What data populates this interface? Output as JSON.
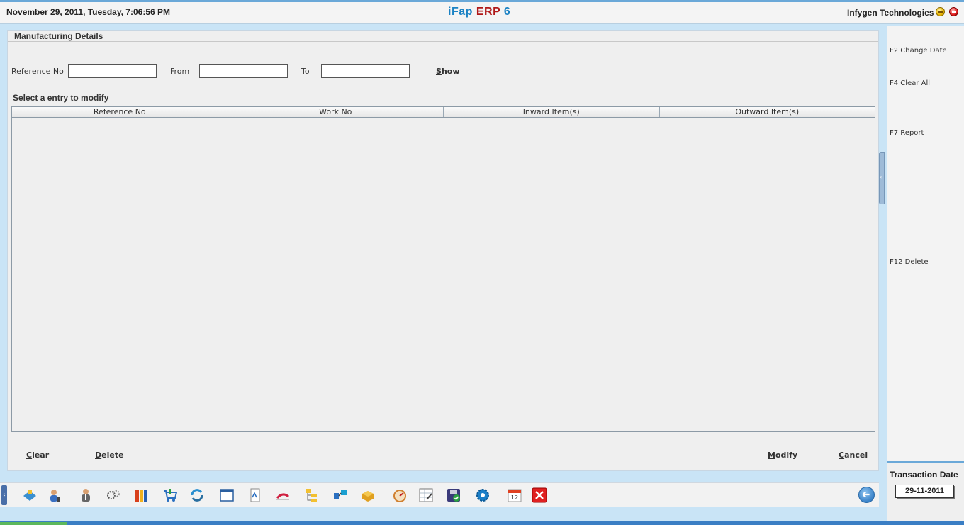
{
  "header": {
    "datetime": "November  29, 2011, Tuesday, 7:06:56 PM",
    "brand_ifap": "iFap",
    "brand_erp": "ERP",
    "brand_version": "6",
    "company": "Infygen Technologies"
  },
  "panel": {
    "title": "Manufacturing Details",
    "filters": {
      "reference_label": "Reference No",
      "reference_value": "",
      "from_label": "From",
      "from_value": "",
      "to_label": "To",
      "to_value": "",
      "show_prefix": "S",
      "show_rest": "how"
    },
    "select_label": "Select a entry to modify",
    "grid": {
      "columns": [
        "Reference No",
        "Work No",
        "Inward Item(s)",
        "Outward Item(s)"
      ],
      "rows": []
    },
    "actions": {
      "clear_prefix": "C",
      "clear_rest": "lear",
      "delete_prefix": "D",
      "delete_rest": "elete",
      "modify_prefix": "M",
      "modify_rest": "odify",
      "cancel_prefix": "C",
      "cancel_rest": "ancel"
    }
  },
  "sidebar": {
    "shortcuts": [
      "F2 Change Date",
      "F4 Clear All",
      "F7 Report",
      "F12 Delete"
    ],
    "transaction_label": "Transaction Date",
    "transaction_date": "29-11-2011"
  },
  "toolbar": {
    "icons": [
      "ledger-icon",
      "user-phone-icon",
      "staff-icon",
      "gears-icon",
      "books-icon",
      "shopping-cart-icon",
      "refresh-icon",
      "window-icon",
      "document-icon",
      "chart-icon",
      "folder-tree-icon",
      "network-icon",
      "package-icon",
      "dial-icon",
      "calculator-sheet-icon",
      "save-check-icon",
      "settings-gear-icon",
      "calendar-icon",
      "exit-icon"
    ],
    "calendar_day": "12"
  }
}
